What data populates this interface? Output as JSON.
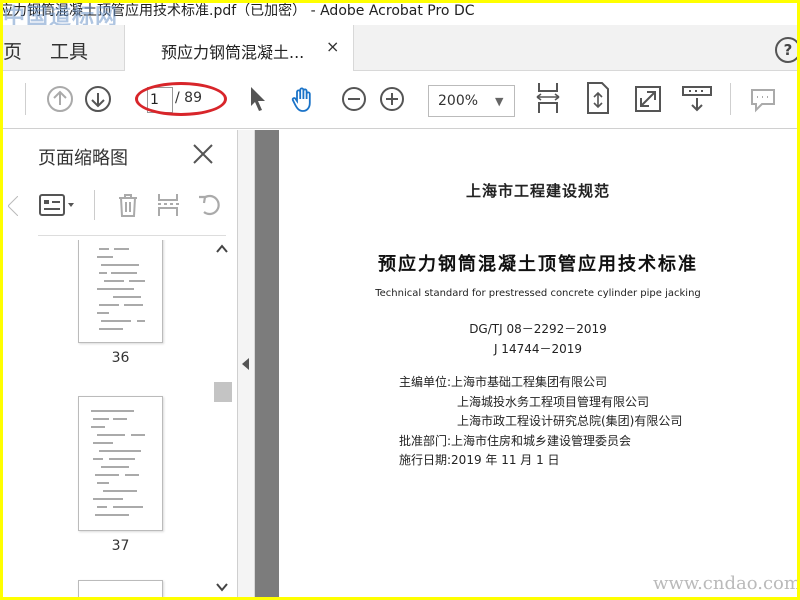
{
  "window": {
    "title": "预应力钢筒混凝土顶管应用技术标准.pdf (已加密) - Adobe Acrobat Pro DC",
    "title_partial": "应力钢筒混凝土顶管应用技术标准.pdf（已加密） - Adobe Acrobat Pro DC",
    "watermark_top": "中国道标网",
    "watermark_bottom": "www.cndao.com"
  },
  "tabs": {
    "home": "页",
    "tools": "工具",
    "document": "预应力钢筒混凝土...",
    "close": "×",
    "help": "?"
  },
  "toolbar": {
    "page_current": "1",
    "page_total": "/ 89",
    "zoom": "200%",
    "highlight_color": "#d8252a"
  },
  "sidebar": {
    "title": "页面缩略图",
    "thumbnails": [
      {
        "page": "36"
      },
      {
        "page": "37"
      }
    ]
  },
  "document": {
    "series": "上海市工程建设规范",
    "title": "预应力钢筒混凝土顶管应用技术标准",
    "title_en": "Technical standard for prestressed concrete cylinder pipe jacking",
    "code1": "DG/TJ 08－2292－2019",
    "code2": "J 14744－2019",
    "lines": [
      "主编单位:上海市基础工程集团有限公司",
      "上海城投水务工程项目管理有限公司",
      "上海市政工程设计研究总院(集团)有限公司",
      "批准部门:上海市住房和城乡建设管理委员会",
      "施行日期:2019 年 11 月 1 日"
    ]
  },
  "colors": {
    "outer_frame": "#ffff00",
    "toolbar_icon": "#555555",
    "hand_tool": "#1a73c8"
  }
}
